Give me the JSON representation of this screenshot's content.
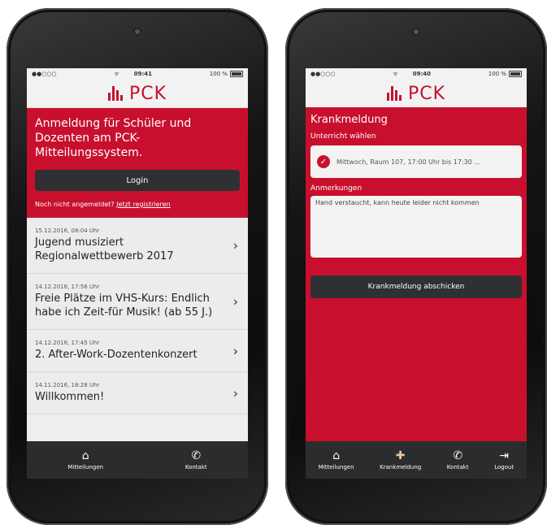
{
  "left": {
    "status": {
      "carrier": "●●○○○",
      "wifi": "ᯤ",
      "time": "09:41",
      "battery": "100 %"
    },
    "brand": "PCK",
    "hero": {
      "title": "Anmeldung für Schüler und Dozenten am PCK-Mitteilungssystem.",
      "login_label": "Login",
      "register_prefix": "Noch nicht angemeldet?",
      "register_link": "Jetzt registrieren"
    },
    "news": [
      {
        "date": "15.12.2016, 08:04 Uhr",
        "title": "Jugend musiziert Regionalwettbewerb 2017"
      },
      {
        "date": "14.12.2016, 17:56 Uhr",
        "title": "Freie Plätze im VHS-Kurs: Endlich habe ich Zeit-für Musik! (ab 55 J.)"
      },
      {
        "date": "14.12.2016, 17:45 Uhr",
        "title": "2. After-Work-Dozentenkonzert"
      },
      {
        "date": "14.11.2016, 18:28 Uhr",
        "title": "Willkommen!"
      }
    ],
    "tabs": {
      "mitteilungen": "Mitteilungen",
      "kontakt": "Kontakt"
    }
  },
  "right": {
    "status": {
      "carrier": "●●○○○",
      "wifi": "ᯤ",
      "time": "09:40",
      "battery": "100 %"
    },
    "brand": "PCK",
    "title": "Krankmeldung",
    "lesson_label": "Unterricht wählen",
    "lesson_value": "Mittwoch, Raum 107, 17:00 Uhr bis 17:30 ...",
    "notes_label": "Anmerkungen",
    "notes_value": "Hand verstaucht, kann heute leider nicht kommen",
    "submit_label": "Krankmeldung abschicken",
    "tabs": {
      "mitteilungen": "Mitteilungen",
      "krankmeldung": "Krankmeldung",
      "kontakt": "Kontakt",
      "logout": "Logout"
    }
  },
  "colors": {
    "brand_red": "#c8102e",
    "dark": "#2f3033",
    "tabbar": "#2b2c2e"
  },
  "icons": {
    "home": "home-icon",
    "phone": "phone-icon",
    "medkit": "medkit-icon",
    "logout": "logout-icon",
    "chevron": "chevron-right-icon",
    "check": "check-icon"
  }
}
